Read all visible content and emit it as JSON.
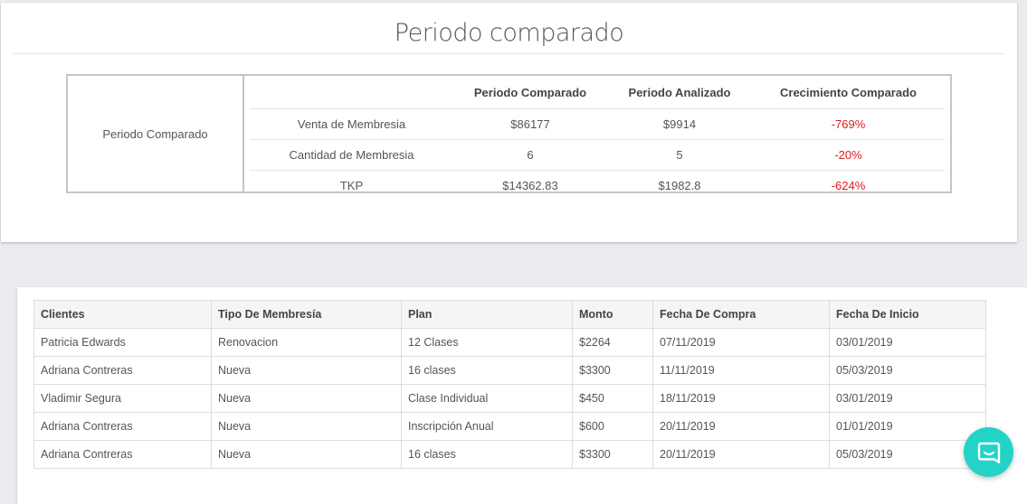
{
  "comparison": {
    "title": "Periodo comparado",
    "row_header": "Periodo Comparado",
    "columns": [
      "",
      "Periodo Comparado",
      "Periodo Analizado",
      "Crecimiento Comparado"
    ],
    "rows": [
      {
        "label": "Venta de Membresia",
        "compared": "$86177",
        "analyzed": "$9914",
        "growth": "-769%"
      },
      {
        "label": "Cantidad de Membresia",
        "compared": "6",
        "analyzed": "5",
        "growth": "-20%"
      },
      {
        "label": "TKP",
        "compared": "$14362.83",
        "analyzed": "$1982.8",
        "growth": "-624%"
      }
    ],
    "negative_color": "#e01b1b"
  },
  "purchases": {
    "columns": [
      "Clientes",
      "Tipo De Membresía",
      "Plan",
      "Monto",
      "Fecha De Compra",
      "Fecha De Inicio"
    ],
    "rows": [
      [
        "Patricia Edwards",
        "Renovacion",
        "12 Clases",
        "$2264",
        "07/11/2019",
        "03/01/2019"
      ],
      [
        "Adriana Contreras",
        "Nueva",
        "16 clases",
        "$3300",
        "11/11/2019",
        "05/03/2019"
      ],
      [
        "Vladimir Segura",
        "Nueva",
        "Clase Individual",
        "$450",
        "18/11/2019",
        "03/01/2019"
      ],
      [
        "Adriana Contreras",
        "Nueva",
        "Inscripción Anual",
        "$600",
        "20/11/2019",
        "01/01/2019"
      ],
      [
        "Adriana Contreras",
        "Nueva",
        "16 clases",
        "$3300",
        "20/11/2019",
        "05/03/2019"
      ]
    ]
  },
  "chat": {
    "icon": "chat-icon",
    "color": "#23d3c7"
  }
}
